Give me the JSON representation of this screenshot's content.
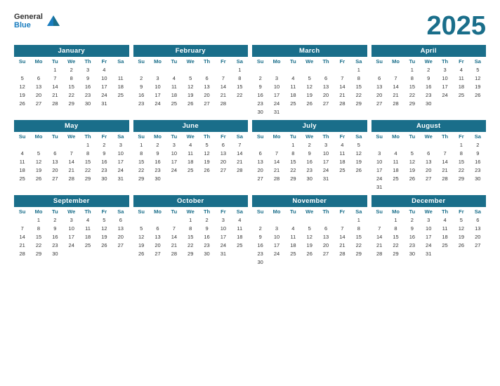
{
  "header": {
    "logo_general": "General",
    "logo_blue": "Blue",
    "year": "2025"
  },
  "months": [
    {
      "name": "January",
      "weeks": [
        [
          "",
          "",
          "1",
          "2",
          "3",
          "4"
        ],
        [
          "5",
          "6",
          "7",
          "8",
          "9",
          "10",
          "11"
        ],
        [
          "12",
          "13",
          "14",
          "15",
          "16",
          "17",
          "18"
        ],
        [
          "19",
          "20",
          "21",
          "22",
          "23",
          "24",
          "25"
        ],
        [
          "26",
          "27",
          "28",
          "29",
          "30",
          "31",
          ""
        ]
      ]
    },
    {
      "name": "February",
      "weeks": [
        [
          "",
          "",
          "",
          "",
          "",
          "",
          "1"
        ],
        [
          "2",
          "3",
          "4",
          "5",
          "6",
          "7",
          "8"
        ],
        [
          "9",
          "10",
          "11",
          "12",
          "13",
          "14",
          "15"
        ],
        [
          "16",
          "17",
          "18",
          "19",
          "20",
          "21",
          "22"
        ],
        [
          "23",
          "24",
          "25",
          "26",
          "27",
          "28",
          ""
        ]
      ]
    },
    {
      "name": "March",
      "weeks": [
        [
          "",
          "",
          "",
          "",
          "",
          "",
          "1"
        ],
        [
          "2",
          "3",
          "4",
          "5",
          "6",
          "7",
          "8"
        ],
        [
          "9",
          "10",
          "11",
          "12",
          "13",
          "14",
          "15"
        ],
        [
          "16",
          "17",
          "18",
          "19",
          "20",
          "21",
          "22"
        ],
        [
          "23",
          "24",
          "25",
          "26",
          "27",
          "28",
          "29"
        ],
        [
          "30",
          "31",
          "",
          "",
          "",
          "",
          ""
        ]
      ]
    },
    {
      "name": "April",
      "weeks": [
        [
          "",
          "",
          "1",
          "2",
          "3",
          "4",
          "5"
        ],
        [
          "6",
          "7",
          "8",
          "9",
          "10",
          "11",
          "12"
        ],
        [
          "13",
          "14",
          "15",
          "16",
          "17",
          "18",
          "19"
        ],
        [
          "20",
          "21",
          "22",
          "23",
          "24",
          "25",
          "26"
        ],
        [
          "27",
          "28",
          "29",
          "30",
          "",
          "",
          ""
        ]
      ]
    },
    {
      "name": "May",
      "weeks": [
        [
          "",
          "",
          "",
          "",
          "1",
          "2",
          "3"
        ],
        [
          "4",
          "5",
          "6",
          "7",
          "8",
          "9",
          "10"
        ],
        [
          "11",
          "12",
          "13",
          "14",
          "15",
          "16",
          "17"
        ],
        [
          "18",
          "19",
          "20",
          "21",
          "22",
          "23",
          "24"
        ],
        [
          "25",
          "26",
          "27",
          "28",
          "29",
          "30",
          "31"
        ]
      ]
    },
    {
      "name": "June",
      "weeks": [
        [
          "1",
          "2",
          "3",
          "4",
          "5",
          "6",
          "7"
        ],
        [
          "8",
          "9",
          "10",
          "11",
          "12",
          "13",
          "14"
        ],
        [
          "15",
          "16",
          "17",
          "18",
          "19",
          "20",
          "21"
        ],
        [
          "22",
          "23",
          "24",
          "25",
          "26",
          "27",
          "28"
        ],
        [
          "29",
          "30",
          "",
          "",
          "",
          "",
          ""
        ]
      ]
    },
    {
      "name": "July",
      "weeks": [
        [
          "",
          "",
          "1",
          "2",
          "3",
          "4",
          "5"
        ],
        [
          "6",
          "7",
          "8",
          "9",
          "10",
          "11",
          "12"
        ],
        [
          "13",
          "14",
          "15",
          "16",
          "17",
          "18",
          "19"
        ],
        [
          "20",
          "21",
          "22",
          "23",
          "24",
          "25",
          "26"
        ],
        [
          "27",
          "28",
          "29",
          "30",
          "31",
          "",
          ""
        ]
      ]
    },
    {
      "name": "August",
      "weeks": [
        [
          "",
          "",
          "",
          "",
          "",
          "1",
          "2"
        ],
        [
          "3",
          "4",
          "5",
          "6",
          "7",
          "8",
          "9"
        ],
        [
          "10",
          "11",
          "12",
          "13",
          "14",
          "15",
          "16"
        ],
        [
          "17",
          "18",
          "19",
          "20",
          "21",
          "22",
          "23"
        ],
        [
          "24",
          "25",
          "26",
          "27",
          "28",
          "29",
          "30"
        ],
        [
          "31",
          "",
          "",
          "",
          "",
          "",
          ""
        ]
      ]
    },
    {
      "name": "September",
      "weeks": [
        [
          "",
          "1",
          "2",
          "3",
          "4",
          "5",
          "6"
        ],
        [
          "7",
          "8",
          "9",
          "10",
          "11",
          "12",
          "13"
        ],
        [
          "14",
          "15",
          "16",
          "17",
          "18",
          "19",
          "20"
        ],
        [
          "21",
          "22",
          "23",
          "24",
          "25",
          "26",
          "27"
        ],
        [
          "28",
          "29",
          "30",
          "",
          "",
          "",
          ""
        ]
      ]
    },
    {
      "name": "October",
      "weeks": [
        [
          "",
          "",
          "",
          "1",
          "2",
          "3",
          "4"
        ],
        [
          "5",
          "6",
          "7",
          "8",
          "9",
          "10",
          "11"
        ],
        [
          "12",
          "13",
          "14",
          "15",
          "16",
          "17",
          "18"
        ],
        [
          "19",
          "20",
          "21",
          "22",
          "23",
          "24",
          "25"
        ],
        [
          "26",
          "27",
          "28",
          "29",
          "30",
          "31",
          ""
        ]
      ]
    },
    {
      "name": "November",
      "weeks": [
        [
          "",
          "",
          "",
          "",
          "",
          "",
          "1"
        ],
        [
          "2",
          "3",
          "4",
          "5",
          "6",
          "7",
          "8"
        ],
        [
          "9",
          "10",
          "11",
          "12",
          "13",
          "14",
          "15"
        ],
        [
          "16",
          "17",
          "18",
          "19",
          "20",
          "21",
          "22"
        ],
        [
          "23",
          "24",
          "25",
          "26",
          "27",
          "28",
          "29"
        ],
        [
          "30",
          "",
          "",
          "",
          "",
          "",
          ""
        ]
      ]
    },
    {
      "name": "December",
      "weeks": [
        [
          "",
          "1",
          "2",
          "3",
          "4",
          "5",
          "6"
        ],
        [
          "7",
          "8",
          "9",
          "10",
          "11",
          "12",
          "13"
        ],
        [
          "14",
          "15",
          "16",
          "17",
          "18",
          "19",
          "20"
        ],
        [
          "21",
          "22",
          "23",
          "24",
          "25",
          "26",
          "27"
        ],
        [
          "28",
          "29",
          "30",
          "31",
          "",
          "",
          ""
        ]
      ]
    }
  ],
  "day_headers": [
    "Su",
    "Mo",
    "Tu",
    "We",
    "Th",
    "Fr",
    "Sa"
  ]
}
